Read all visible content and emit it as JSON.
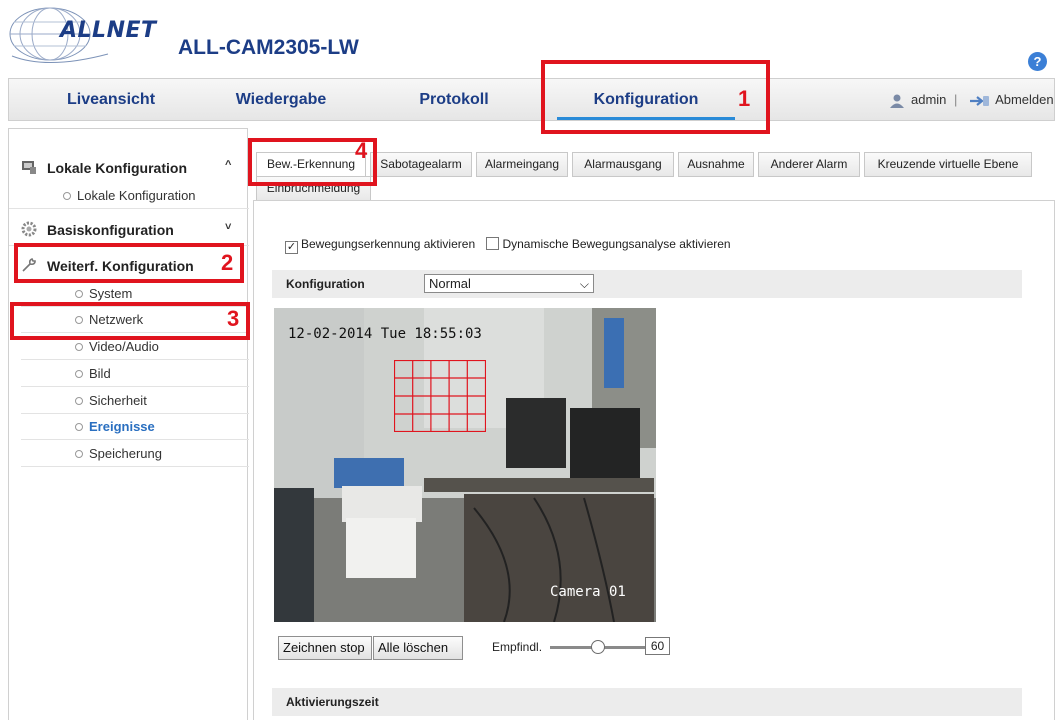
{
  "brand": {
    "logo_text": "ALLNET",
    "model": "ALL-CAM2305-LW",
    "help_glyph": "?"
  },
  "nav": {
    "tabs": [
      "Liveansicht",
      "Wiedergabe",
      "Protokoll",
      "Konfiguration"
    ],
    "active": "Konfiguration",
    "user": "admin",
    "separator": "|",
    "logout": "Abmelden"
  },
  "sidebar": {
    "sections": [
      {
        "label": "Lokale Konfiguration",
        "chevron": "^",
        "icon": "monitor-icon"
      },
      {
        "label": "Basiskonfiguration",
        "chevron": "˅",
        "icon": "gear-icon"
      },
      {
        "label": "Weiterf. Konfiguration",
        "icon": "wrench-icon"
      }
    ],
    "local_items": [
      "Lokale Konfiguration"
    ],
    "advanced_items": [
      "System",
      "Netzwerk",
      "Video/Audio",
      "Bild",
      "Sicherheit",
      "Ereignisse",
      "Speicherung"
    ],
    "active_item": "Ereignisse"
  },
  "subtabs": {
    "row1": [
      "Bew.-Erkennung",
      "Sabotagealarm",
      "Alarmeingang",
      "Alarmausgang",
      "Ausnahme",
      "Anderer Alarm",
      "Kreuzende virtuelle Ebene"
    ],
    "row2": [
      "Einbruchmeldung"
    ],
    "active": "Bew.-Erkennung"
  },
  "motion": {
    "enable_label": "Bewegungserkennung aktivieren",
    "enable_checked": true,
    "dynamic_label": "Dynamische Bewegungsanalyse aktivieren",
    "dynamic_checked": false,
    "config_label": "Konfiguration",
    "config_value": "Normal",
    "osd_time": "12-02-2014 Tue 18:55:03",
    "osd_camera": "Camera 01",
    "draw_button": "Zeichnen stop",
    "clear_button": "Alle löschen",
    "sensitivity_label": "Empfindl.",
    "sensitivity_value": "60",
    "sensitivity_fraction": 0.5,
    "schedule_label": "Aktivierungszeit"
  },
  "callouts": [
    "1",
    "2",
    "3",
    "4"
  ],
  "colors": {
    "brand_blue": "#1c3d86",
    "accent_blue": "#2a8bd8",
    "callout_red": "#e0141e",
    "motion_grid": "#e0141e"
  }
}
